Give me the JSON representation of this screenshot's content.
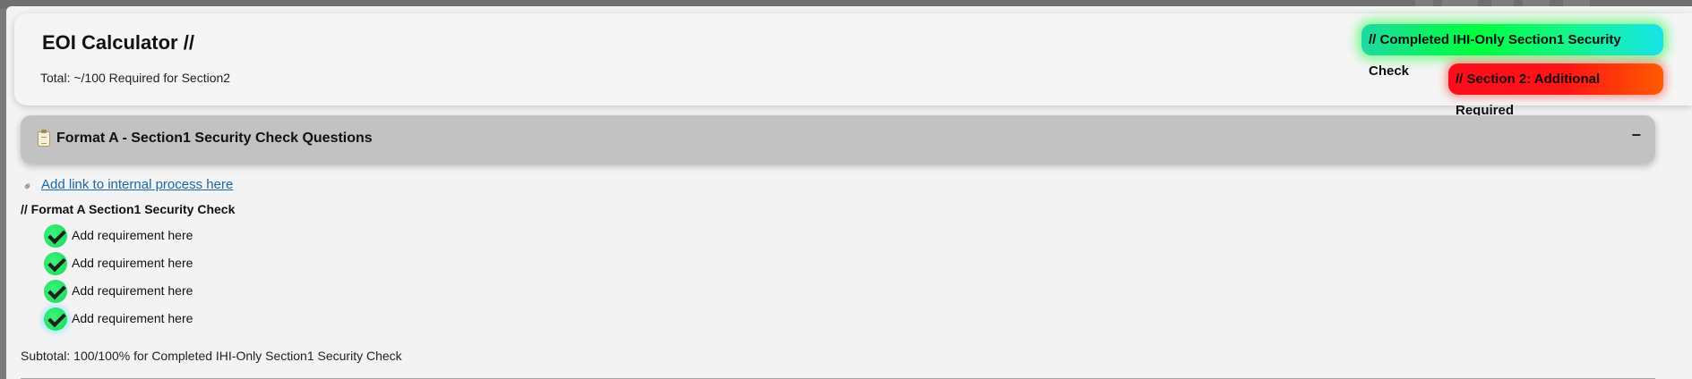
{
  "header": {
    "title": "EOI Calculator //",
    "total_text": "Total: ~/100 Required for Section2"
  },
  "status": {
    "completed_label": "// Completed IHI-Only Section1 Security Check",
    "additional_label": "// Section 2: Additional Required",
    "completed_color": "#00ff3c",
    "additional_color": "#ff1515"
  },
  "accordion": {
    "icon": "clipboard-icon",
    "title": "Format A - Section1 Security Check Questions",
    "toggle": "−"
  },
  "section": {
    "link_icon": "link-icon",
    "link_text": "Add link to internal process here",
    "heading": "// Format A Section1 Security Check",
    "requirements": [
      {
        "label": "Add requirement here",
        "checked": true
      },
      {
        "label": "Add requirement here",
        "checked": true
      },
      {
        "label": "Add requirement here",
        "checked": true
      },
      {
        "label": "Add requirement here",
        "checked": true
      }
    ],
    "subtotal": "Subtotal: 100/100% for Completed IHI-Only Section1 Security Check"
  }
}
